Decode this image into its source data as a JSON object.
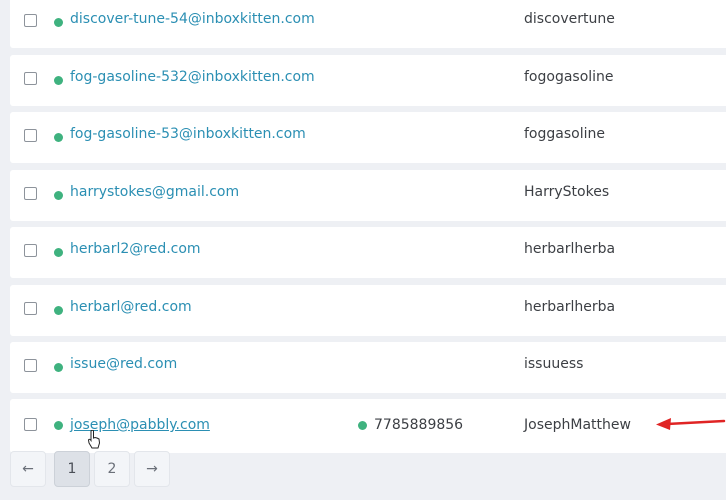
{
  "rows": [
    {
      "email": "discover-tune-54@inboxkitten.com",
      "phone": "",
      "name": "discovertune"
    },
    {
      "email": "fog-gasoline-532@inboxkitten.com",
      "phone": "",
      "name": "fogogasoline"
    },
    {
      "email": "fog-gasoline-53@inboxkitten.com",
      "phone": "",
      "name": "foggasoline"
    },
    {
      "email": "harrystokes@gmail.com",
      "phone": "",
      "name": "HarryStokes"
    },
    {
      "email": "herbarl2@red.com",
      "phone": "",
      "name": "herbarlherba"
    },
    {
      "email": "herbarl@red.com",
      "phone": "",
      "name": "herbarlherba"
    },
    {
      "email": "issue@red.com",
      "phone": "",
      "name": "issuuess"
    },
    {
      "email": "joseph@pabbly.com",
      "phone": "7785889856",
      "name": "JosephMatthew"
    }
  ],
  "pagination": {
    "prev_label": "←",
    "pages": [
      "1",
      "2"
    ],
    "next_label": "→",
    "current_page": "1"
  },
  "colors": {
    "status_dot": "#3fb27f",
    "email_link": "#2b8fb3",
    "annotation_arrow": "#e02424"
  },
  "icons": {
    "cursor": "hand-pointer-icon",
    "annotation": "red-arrow-icon"
  }
}
